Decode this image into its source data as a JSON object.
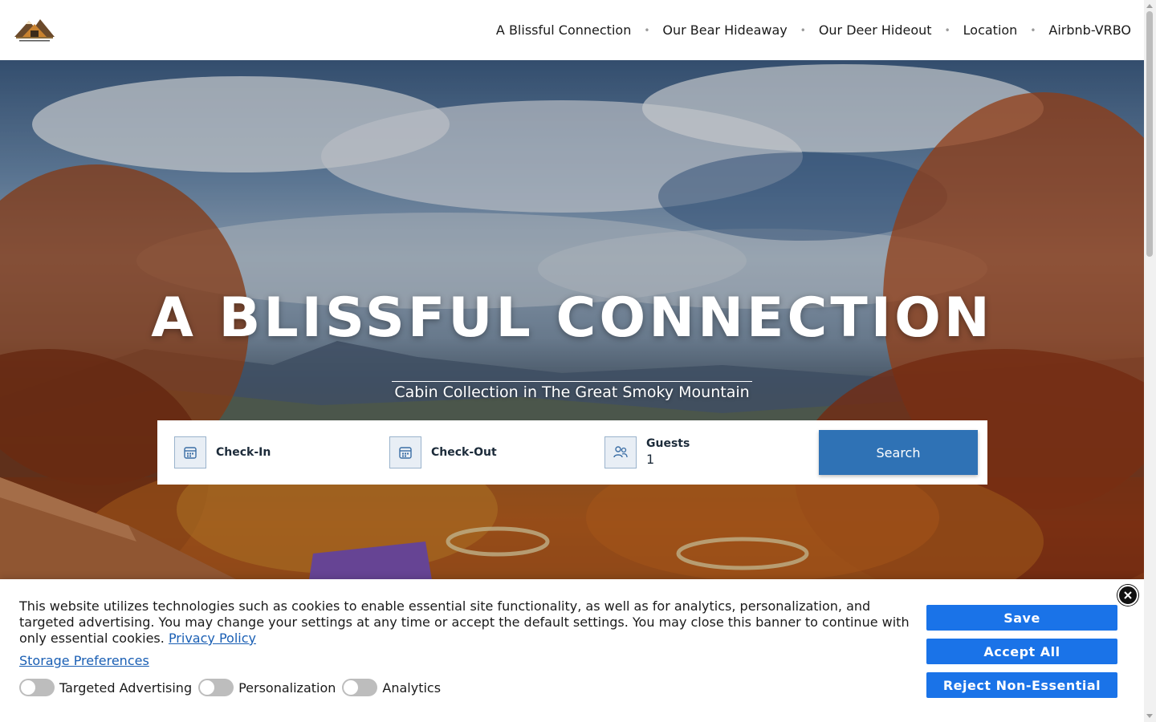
{
  "nav": {
    "items": [
      {
        "label": "A Blissful Connection"
      },
      {
        "label": "Our Bear Hideaway"
      },
      {
        "label": "Our Deer Hideout"
      },
      {
        "label": "Location"
      },
      {
        "label": "Airbnb-VRBO"
      }
    ],
    "separator": "•"
  },
  "hero": {
    "title": "A BLISSFUL CONNECTION",
    "subtitle": "Cabin Collection in The Great Smoky Mountain"
  },
  "search": {
    "checkin_label": "Check-In",
    "checkout_label": "Check-Out",
    "guests_label": "Guests",
    "guests_value": "1",
    "button_label": "Search",
    "accent_color": "#2f72b5"
  },
  "cookie": {
    "text": "This website utilizes technologies such as cookies to enable essential site functionality, as well as for analytics, personalization, and targeted advertising. You may change your settings at any time or accept the default settings. You may close this banner to continue with only essential cookies.",
    "privacy_link": "Privacy Policy",
    "storage_link": "Storage Preferences",
    "toggles": [
      {
        "label": "Targeted Advertising",
        "on": false
      },
      {
        "label": "Personalization",
        "on": false
      },
      {
        "label": "Analytics",
        "on": false
      }
    ],
    "buttons": {
      "save": "Save",
      "accept": "Accept All",
      "reject": "Reject Non-Essential"
    },
    "button_color": "#1a73e8"
  }
}
